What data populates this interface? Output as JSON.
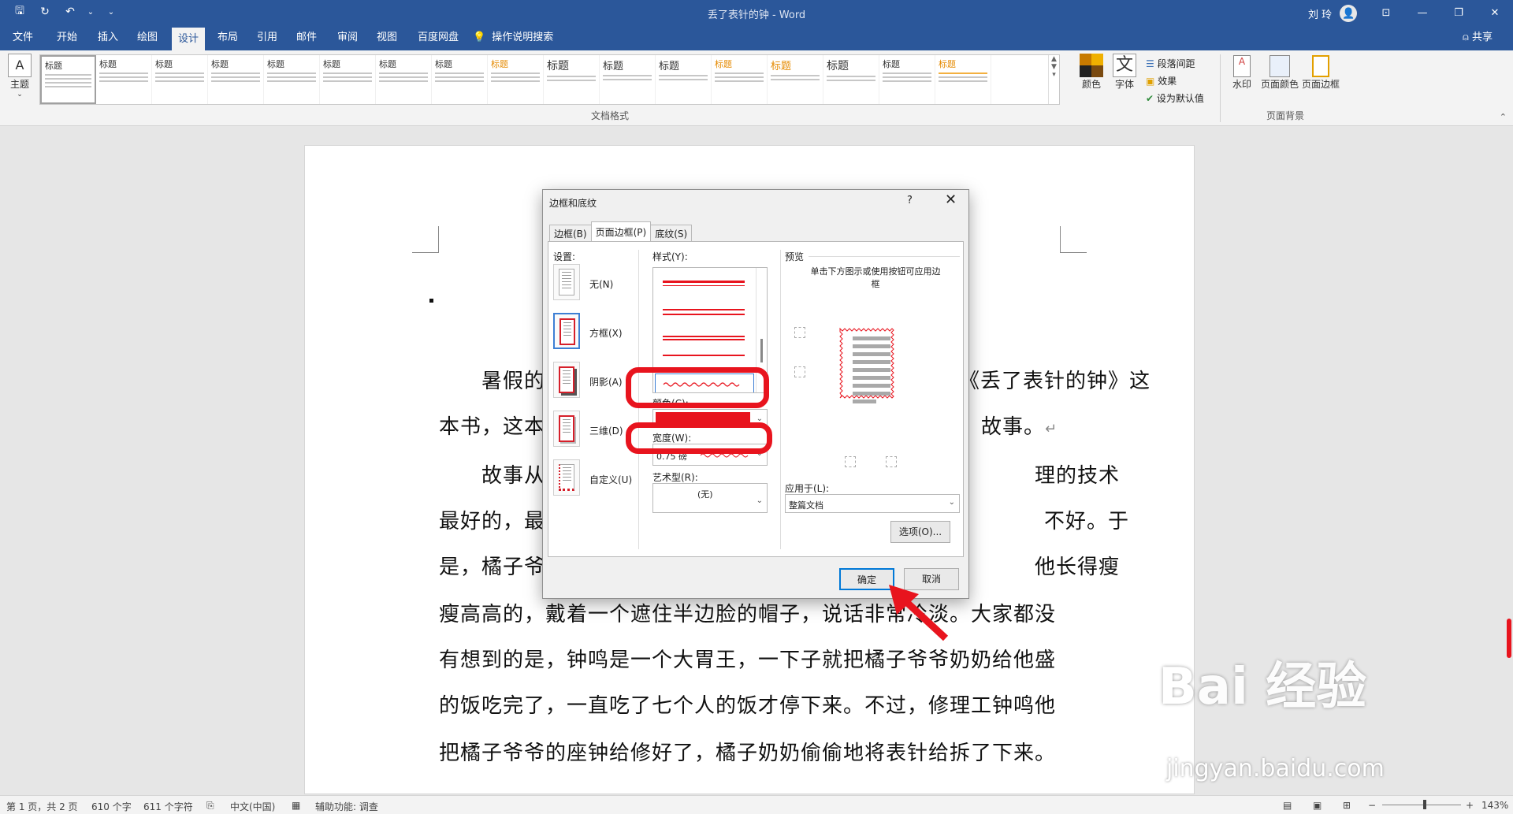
{
  "titlebar": {
    "doc_title": "丢了表针的钟 - Word",
    "user": "刘 玲",
    "avatar_initial": "👤"
  },
  "qat": {
    "save": "🖫",
    "autosave": "↻",
    "undo": "↶",
    "undo_more": "⌄",
    "customize": "⌄"
  },
  "window": {
    "ribbon_display": "⊡",
    "minimize": "—",
    "restore": "❐",
    "close": "✕"
  },
  "tabs": [
    "文件",
    "开始",
    "插入",
    "绘图",
    "设计",
    "布局",
    "引用",
    "邮件",
    "审阅",
    "视图",
    "百度网盘"
  ],
  "active_tab": "设计",
  "search": {
    "icon": "💡",
    "label": "操作说明搜索"
  },
  "share": "共享",
  "ribbon": {
    "theme_label": "主题",
    "gallery_heading": "标题",
    "colors_label": "颜色",
    "fonts_label": "字体",
    "font_glyph": "文",
    "paragraph_spacing": "段落间距",
    "effects": "效果",
    "set_default": "设为默认值",
    "doc_format_group": "文档格式",
    "watermark": "水印",
    "page_color": "页面颜色",
    "page_borders": "页面边框",
    "page_bg_group": "页面背景"
  },
  "document": {
    "lines": [
      "暑假的",
      "《丢了表针的钟》这",
      "本书，这本",
      "故事。",
      "故事从",
      "理的技术",
      "最好的，最",
      "不好。于",
      "是，橘子爷",
      "他长得瘦",
      "瘦高高的，戴着一个遮住半边脸的帽子，说话非常冷淡。大家都没",
      "有想到的是，钟鸣是一个大胃王，一下子就把橘子爷爷奶奶给他盛",
      "的饭吃完了，一直吃了七个人的饭才停下来。不过，修理工钟鸣他",
      "把橘子爷爷的座钟给修好了，橘子奶奶偷偷地将表针给拆了下来。"
    ],
    "return_mark": "↵"
  },
  "dialog": {
    "title": "边框和底纹",
    "help": "?",
    "close": "✕",
    "tabs": [
      "边框(B)",
      "页面边框(P)",
      "底纹(S)"
    ],
    "active_tab": "页面边框(P)",
    "setting_label": "设置:",
    "settings": [
      "无(N)",
      "方框(X)",
      "阴影(A)",
      "三维(D)",
      "自定义(U)"
    ],
    "style_label": "样式(Y):",
    "color_label": "颜色(C):",
    "width_label": "宽度(W):",
    "width_value": "0.75 磅",
    "art_label": "艺术型(R):",
    "art_value": "(无)",
    "preview_label": "预览",
    "preview_hint": "单击下方图示或使用按钮可应用边框",
    "apply_label": "应用于(L):",
    "apply_value": "整篇文档",
    "options_button": "选项(O)...",
    "ok_button": "确定",
    "cancel_button": "取消",
    "border_color": "#e8141e"
  },
  "status": {
    "page": "第 1 页，共 2 页",
    "words": "610 个字",
    "chars": "611 个字符",
    "language": "中文(中国)",
    "accessibility": "辅助功能: 调查",
    "zoom": "143%"
  },
  "watermark": {
    "brand": "Bai 经验",
    "url": "jingyan.baidu.com"
  }
}
